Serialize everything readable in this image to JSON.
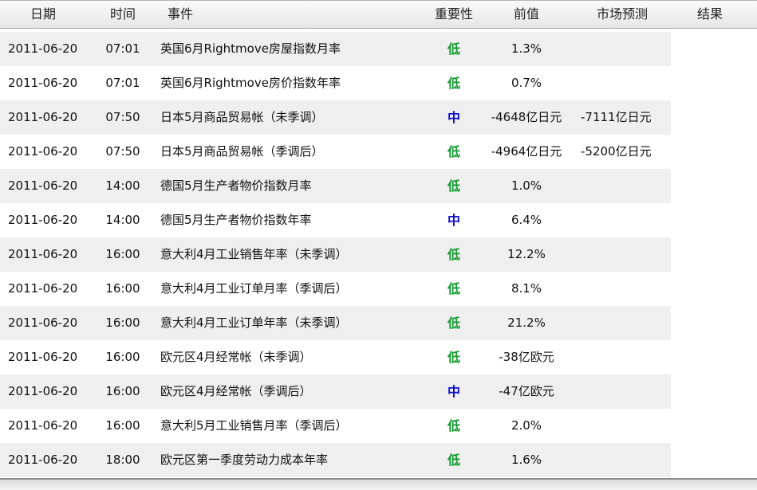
{
  "colors": {
    "importance_low": "#119a2d",
    "importance_mid": "#1010cc",
    "row_alt_background": "#efefef"
  },
  "header": {
    "date": "日期",
    "time": "时间",
    "event": "事件",
    "importance": "重要性",
    "previous": "前值",
    "forecast": "市场预测",
    "result": "结果"
  },
  "rows": [
    {
      "date": "2011-06-20",
      "time": "07:01",
      "event": "英国6月Rightmove房屋指数月率",
      "importance": "低",
      "level": "low",
      "previous": "1.3%",
      "forecast": "",
      "result": ""
    },
    {
      "date": "2011-06-20",
      "time": "07:01",
      "event": "英国6月Rightmove房价指数年率",
      "importance": "低",
      "level": "low",
      "previous": "0.7%",
      "forecast": "",
      "result": ""
    },
    {
      "date": "2011-06-20",
      "time": "07:50",
      "event": "日本5月商品贸易帐（未季调）",
      "importance": "中",
      "level": "mid",
      "previous": "-4648亿日元",
      "forecast": "-7111亿日元",
      "result": ""
    },
    {
      "date": "2011-06-20",
      "time": "07:50",
      "event": "日本5月商品贸易帐（季调后）",
      "importance": "低",
      "level": "low",
      "previous": "-4964亿日元",
      "forecast": "-5200亿日元",
      "result": ""
    },
    {
      "date": "2011-06-20",
      "time": "14:00",
      "event": "德国5月生产者物价指数月率",
      "importance": "低",
      "level": "low",
      "previous": "1.0%",
      "forecast": "",
      "result": ""
    },
    {
      "date": "2011-06-20",
      "time": "14:00",
      "event": "德国5月生产者物价指数年率",
      "importance": "中",
      "level": "mid",
      "previous": "6.4%",
      "forecast": "",
      "result": ""
    },
    {
      "date": "2011-06-20",
      "time": "16:00",
      "event": "意大利4月工业销售年率（未季调）",
      "importance": "低",
      "level": "low",
      "previous": "12.2%",
      "forecast": "",
      "result": ""
    },
    {
      "date": "2011-06-20",
      "time": "16:00",
      "event": "意大利4月工业订单月率（季调后）",
      "importance": "低",
      "level": "low",
      "previous": "8.1%",
      "forecast": "",
      "result": ""
    },
    {
      "date": "2011-06-20",
      "time": "16:00",
      "event": "意大利4月工业订单年率（未季调）",
      "importance": "低",
      "level": "low",
      "previous": "21.2%",
      "forecast": "",
      "result": ""
    },
    {
      "date": "2011-06-20",
      "time": "16:00",
      "event": "欧元区4月经常帐（未季调）",
      "importance": "低",
      "level": "low",
      "previous": "-38亿欧元",
      "forecast": "",
      "result": ""
    },
    {
      "date": "2011-06-20",
      "time": "16:00",
      "event": "欧元区4月经常帐（季调后）",
      "importance": "中",
      "level": "mid",
      "previous": "-47亿欧元",
      "forecast": "",
      "result": ""
    },
    {
      "date": "2011-06-20",
      "time": "16:00",
      "event": "意大利5月工业销售月率（季调后）",
      "importance": "低",
      "level": "low",
      "previous": "2.0%",
      "forecast": "",
      "result": ""
    },
    {
      "date": "2011-06-20",
      "time": "18:00",
      "event": "欧元区第一季度劳动力成本年率",
      "importance": "低",
      "level": "low",
      "previous": "1.6%",
      "forecast": "",
      "result": ""
    }
  ]
}
